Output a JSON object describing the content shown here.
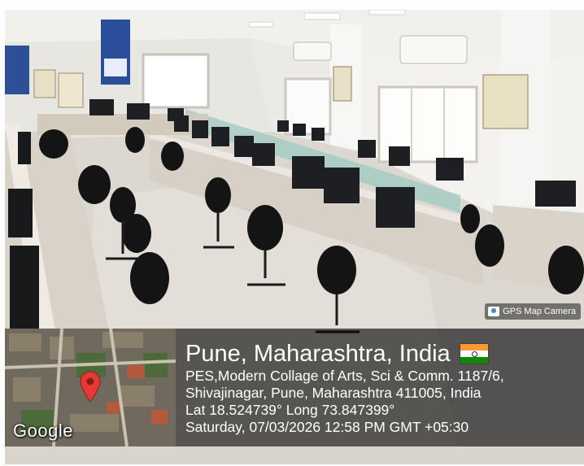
{
  "photo": {
    "description_icon": "computer-lab-photo"
  },
  "badge": {
    "label": "GPS Map Camera",
    "icon": "camera-icon"
  },
  "location": {
    "title": "Pune, Maharashtra, India",
    "address_line1": "PES,Modern Collage of Arts, Sci & Comm. 1187/6,",
    "address_line2": "Shivajinagar, Pune, Maharashtra 411005, India",
    "coords": "Lat 18.524739° Long 73.847399°",
    "datetime": "Saturday, 07/03/2026 12:58 PM GMT +05:30",
    "flag_icon": "india-flag-icon"
  },
  "map": {
    "brand": "Google",
    "pin_icon": "location-pin-icon",
    "pin_color": "#e53935"
  }
}
